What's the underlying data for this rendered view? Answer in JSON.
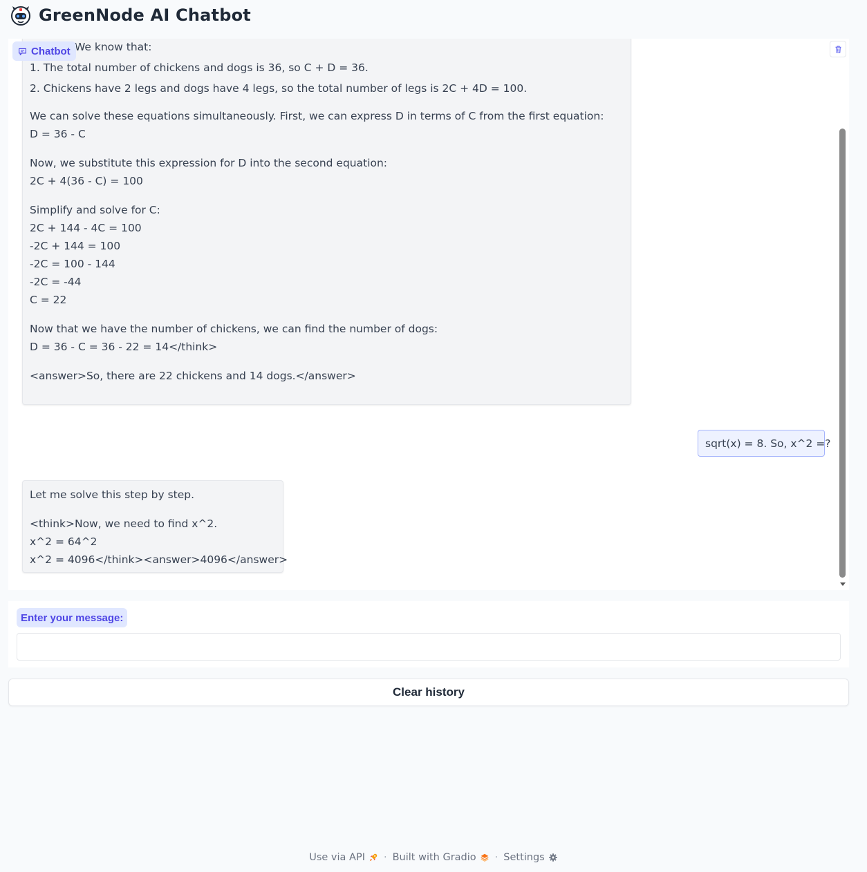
{
  "header": {
    "title": "GreenNode AI Chatbot"
  },
  "chatbot": {
    "label": "Chatbot",
    "messages": [
      {
        "role": "bot",
        "clipped_top": "<think>We know that:",
        "list": [
          "1. The total number of chickens and dogs is 36, so C + D = 36.",
          "2. Chickens have 2 legs and dogs have 4 legs, so the total number of legs is 2C + 4D = 100."
        ],
        "paragraphs": [
          [
            "We can solve these equations simultaneously. First, we can express D in terms of C from the first equation:",
            "D = 36 - C"
          ],
          [
            "Now, we substitute this expression for D into the second equation:",
            "2C + 4(36 - C) = 100"
          ],
          [
            "Simplify and solve for C:",
            "2C + 144 - 4C = 100",
            "-2C + 144 = 100",
            "-2C = 100 - 144",
            "-2C = -44",
            "C = 22"
          ],
          [
            "Now that we have the number of chickens, we can find the number of dogs:",
            "D = 36 - C = 36 - 22 = 14</think>"
          ],
          [
            "<answer>So, there are 22 chickens and 14 dogs.</answer>"
          ]
        ]
      },
      {
        "role": "user",
        "text": "sqrt(x) = 8. So, x^2 =?"
      },
      {
        "role": "bot",
        "paragraphs": [
          [
            "Let me solve this step by step."
          ],
          [
            "<think>Now, we need to find x^2.",
            "x^2 = 64^2",
            "x^2 = 4096</think><answer>4096</answer>"
          ]
        ]
      }
    ]
  },
  "input": {
    "label": "Enter your message:",
    "value": "",
    "placeholder": ""
  },
  "actions": {
    "clear_label": "Clear history"
  },
  "footer": {
    "api_label": "Use via API",
    "built_label": "Built with Gradio",
    "settings_label": "Settings",
    "separator": "·"
  },
  "icons": {
    "logo": "robot-logo-icon",
    "chatbot": "chat-bubble-icon",
    "trash": "trash-icon",
    "api": "rocket-icon",
    "gradio": "gradio-logo-icon",
    "settings": "gear-icon"
  },
  "colors": {
    "accent": "#4f46e5",
    "accent_bg": "#e0e7ff",
    "user_bubble_bg": "#eef2ff",
    "user_bubble_border": "#a5b4fc",
    "bot_bubble_bg": "#f3f4f6",
    "page_bg": "#f8fafc"
  }
}
